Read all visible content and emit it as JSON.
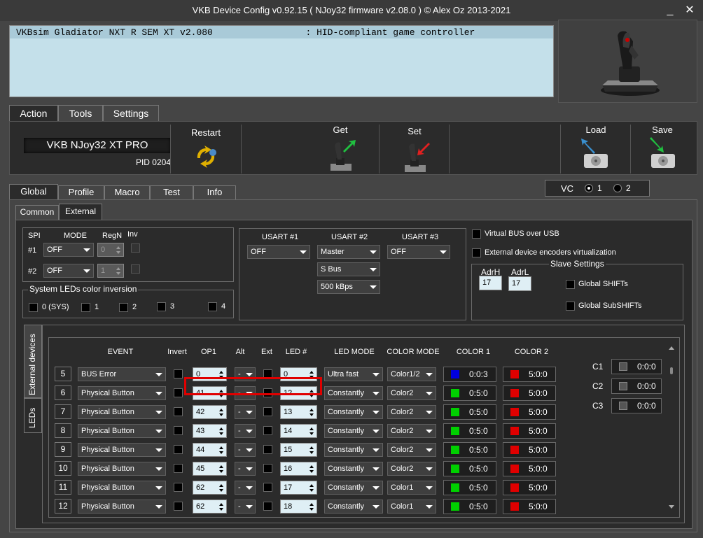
{
  "window": {
    "title": "VKB Device Config v0.92.15 ( NJoy32 firmware v2.08.0 ) © Alex Oz 2013-2021",
    "minimize": "_",
    "close": "✕"
  },
  "device_list": {
    "row": "VKBsim Gladiator NXT R SEM XT v2.080                 : HID-compliant game controller"
  },
  "main_tabs": [
    {
      "label": "Action"
    },
    {
      "label": "Tools"
    },
    {
      "label": "Settings"
    }
  ],
  "action": {
    "device_name": "VKB NJoy32 XT PRO",
    "pid": "PID 0204",
    "restart": "Restart",
    "get": "Get",
    "set": "Set",
    "load": "Load",
    "save": "Save"
  },
  "vc": {
    "label": "VC",
    "opt1": "1",
    "opt2": "2"
  },
  "sub_tabs": [
    {
      "label": "Global"
    },
    {
      "label": "Profile"
    },
    {
      "label": "Macro"
    },
    {
      "label": "Test"
    },
    {
      "label": "Info"
    }
  ],
  "inner_tabs": [
    {
      "label": "Common"
    },
    {
      "label": "External"
    }
  ],
  "spi": {
    "hdr_spi": "SPI",
    "hdr_mode": "MODE",
    "hdr_regn": "RegN",
    "hdr_inv": "Inv",
    "rows": [
      {
        "label": "#1",
        "mode": "OFF",
        "regn": "0"
      },
      {
        "label": "#2",
        "mode": "OFF",
        "regn": "1"
      }
    ]
  },
  "sysled": {
    "title": "System LEDs color inversion",
    "items": [
      "0 (SYS)",
      "1",
      "2",
      "3",
      "4"
    ]
  },
  "usart": {
    "h1": "USART #1",
    "h2": "USART #2",
    "h3": "USART #3",
    "u1": "OFF",
    "u2_mode": "Master",
    "u2_bus": "S Bus",
    "u2_speed": "500 kBps",
    "u3": "OFF"
  },
  "virtual": {
    "vbus": "Virtual BUS over USB",
    "encoders": "External device encoders virtualization"
  },
  "slave": {
    "title": "Slave Settings",
    "adrh_label": "AdrH",
    "adrl_label": "AdrL",
    "adrh": "17",
    "adrl": "17",
    "gshifts": "Global SHIFTs",
    "gsubshifts": "Global SubSHIFTs"
  },
  "side_tabs": {
    "ext": "External devices",
    "leds": "LEDs"
  },
  "led_table": {
    "headers": {
      "event": "EVENT",
      "invert": "Invert",
      "op1": "OP1",
      "alt": "Alt",
      "ext": "Ext",
      "led": "LED #",
      "ledmode": "LED MODE",
      "colormode": "COLOR MODE",
      "color1": "COLOR 1",
      "color2": "COLOR 2"
    },
    "rows": [
      {
        "n": "5",
        "event": "BUS Error",
        "op1": "0",
        "alt": "-",
        "led": "0",
        "mode": "Ultra fast",
        "cmode": "Color1/2",
        "c1": "0:0:3",
        "c1col": "#0000e0",
        "c2": "5:0:0",
        "c2col": "#e00000"
      },
      {
        "n": "6",
        "event": "Physical Button",
        "op1": "41",
        "alt": "-",
        "led": "12",
        "mode": "Constantly",
        "cmode": "Color2",
        "c1": "0:5:0",
        "c1col": "#00d000",
        "c2": "5:0:0",
        "c2col": "#e00000"
      },
      {
        "n": "7",
        "event": "Physical Button",
        "op1": "42",
        "alt": "-",
        "led": "13",
        "mode": "Constantly",
        "cmode": "Color2",
        "c1": "0:5:0",
        "c1col": "#00d000",
        "c2": "5:0:0",
        "c2col": "#e00000"
      },
      {
        "n": "8",
        "event": "Physical Button",
        "op1": "43",
        "alt": "-",
        "led": "14",
        "mode": "Constantly",
        "cmode": "Color2",
        "c1": "0:5:0",
        "c1col": "#00d000",
        "c2": "5:0:0",
        "c2col": "#e00000"
      },
      {
        "n": "9",
        "event": "Physical Button",
        "op1": "44",
        "alt": "-",
        "led": "15",
        "mode": "Constantly",
        "cmode": "Color2",
        "c1": "0:5:0",
        "c1col": "#00d000",
        "c2": "5:0:0",
        "c2col": "#e00000"
      },
      {
        "n": "10",
        "event": "Physical Button",
        "op1": "45",
        "alt": "-",
        "led": "16",
        "mode": "Constantly",
        "cmode": "Color2",
        "c1": "0:5:0",
        "c1col": "#00d000",
        "c2": "5:0:0",
        "c2col": "#e00000"
      },
      {
        "n": "11",
        "event": "Physical Button",
        "op1": "62",
        "alt": "-",
        "led": "17",
        "mode": "Constantly",
        "cmode": "Color1",
        "c1": "0:5:0",
        "c1col": "#00d000",
        "c2": "5:0:0",
        "c2col": "#e00000"
      },
      {
        "n": "12",
        "event": "Physical Button",
        "op1": "62",
        "alt": "-",
        "led": "18",
        "mode": "Constantly",
        "cmode": "Color1",
        "c1": "0:5:0",
        "c1col": "#00d000",
        "c2": "5:0:0",
        "c2col": "#e00000"
      }
    ]
  },
  "channels": [
    {
      "label": "C1",
      "value": "0:0:0"
    },
    {
      "label": "C2",
      "value": "0:0:0"
    },
    {
      "label": "C3",
      "value": "0:0:0"
    }
  ],
  "colors": {
    "highlight": "#e00000"
  }
}
